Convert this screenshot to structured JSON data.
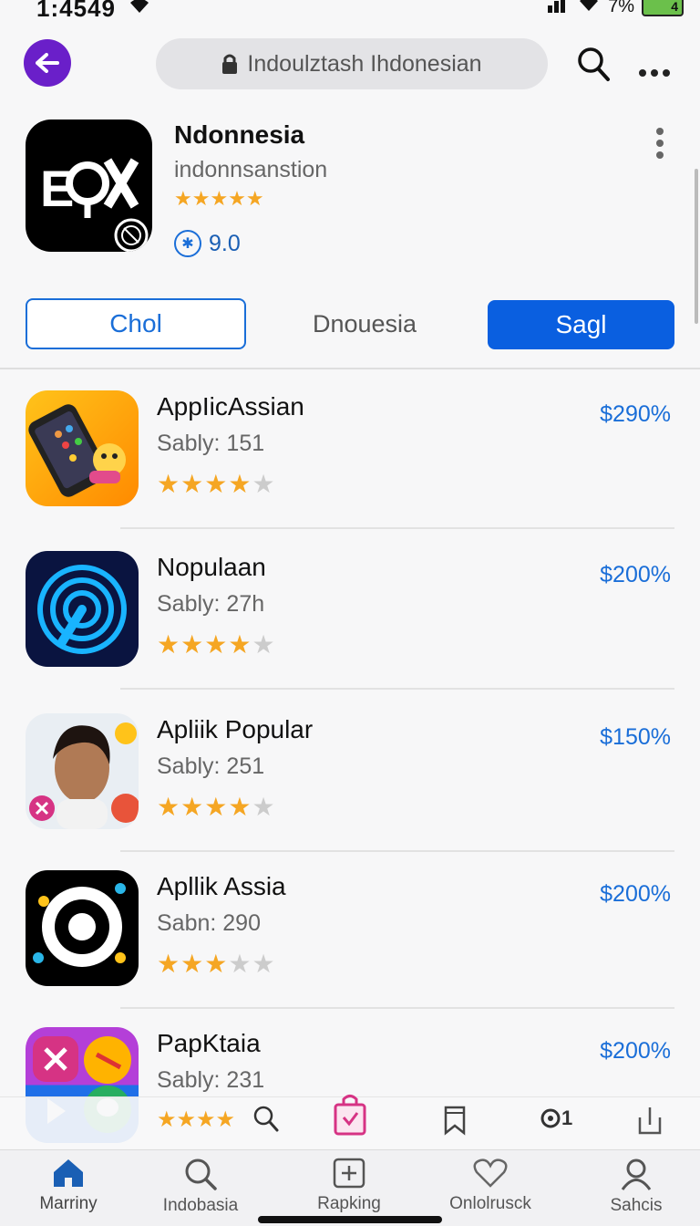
{
  "status": {
    "time": "1:4549",
    "battery_level": "4",
    "battery_pct": "7%"
  },
  "topbar": {
    "url": "Indoulztash Ihdonesian",
    "back_icon": "arrow-left-icon",
    "search_icon": "search-icon",
    "more_icon": "more-horizontal-icon"
  },
  "app": {
    "title": "Ndonnesia",
    "subtitle": "indonnsanstion",
    "stars": "★★★★★",
    "rating": "9.0"
  },
  "segments": {
    "left": "Chol",
    "middle": "Dnouesia",
    "right": "Sagl"
  },
  "items": [
    {
      "name": "AppIicAssian",
      "sub": "Sably: 151",
      "rating": 4,
      "price": "$290%"
    },
    {
      "name": "Nopulaan",
      "sub": "Sably: 27h",
      "rating": 4,
      "price": "$200%"
    },
    {
      "name": "Apliik Popular",
      "sub": "Sably: 251",
      "rating": 4,
      "price": "$150%"
    },
    {
      "name": "Apllik Assia",
      "sub": "Sabn: 290",
      "rating": 3,
      "price": "$200%"
    },
    {
      "name": "PapKtaia",
      "sub": "Sably: 231",
      "rating": 4,
      "price": "$200%"
    }
  ],
  "toolbar": {
    "stars": "★★★★",
    "icons": [
      "search-icon",
      "shopping-bag-icon",
      "bookmark-icon",
      "refresh-icon",
      "share-icon"
    ],
    "refresh_label": "1"
  },
  "tabs": [
    {
      "label": "Marriny",
      "icon": "home-icon"
    },
    {
      "label": "Indobasia",
      "icon": "search-icon"
    },
    {
      "label": "Rapking",
      "icon": "add-square-icon"
    },
    {
      "label": "Onlolrusck",
      "icon": "heart-icon"
    },
    {
      "label": "Sahcis",
      "icon": "profile-icon"
    }
  ],
  "colors": {
    "accent": "#1a6ed8",
    "primary_button": "#0a5fe0",
    "back_button": "#6a1fc9",
    "star": "#f5a623"
  }
}
